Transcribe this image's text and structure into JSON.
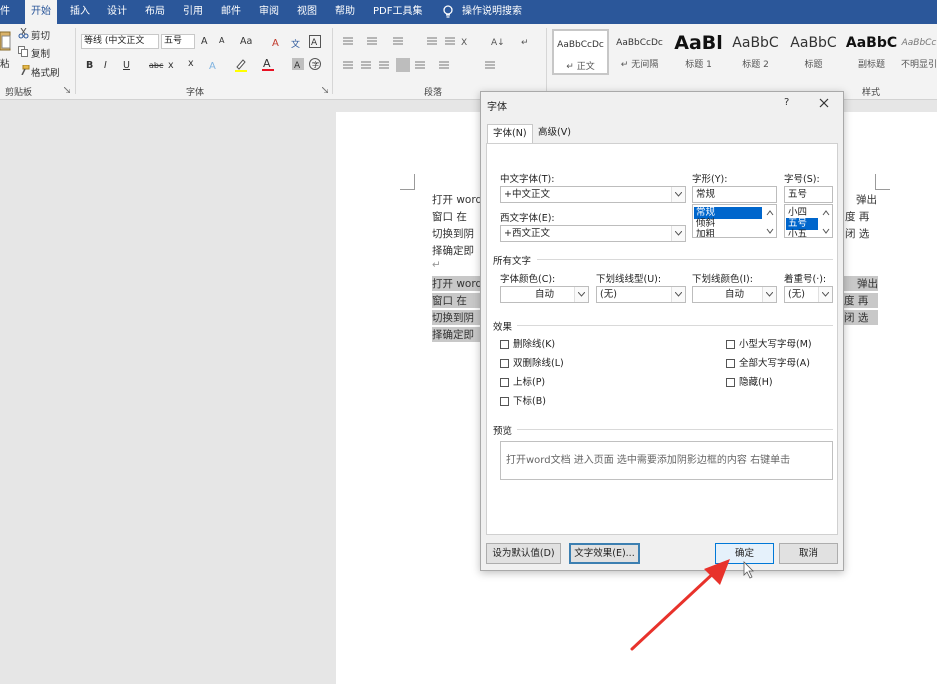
{
  "ribbon": {
    "tabs": [
      "件",
      "开始",
      "插入",
      "设计",
      "布局",
      "引用",
      "邮件",
      "审阅",
      "视图",
      "帮助",
      "PDF工具集",
      "操作说明搜索"
    ],
    "clipboard": {
      "cut": "剪切",
      "copy": "复制",
      "paste": "粘",
      "format_painter": "格式刷",
      "label": "剪贴板"
    },
    "font": {
      "name": "等线 (中文正文",
      "size": "五号",
      "grow": "A",
      "shrink": "A",
      "case": "Aa",
      "bold": "B",
      "italic": "I",
      "underline": "U",
      "strike": "abc",
      "subscript": "x",
      "superscript": "x",
      "label": "字体"
    },
    "paragraph": {
      "label": "段落"
    },
    "styles": {
      "label": "样式",
      "items": [
        {
          "preview": "AaBbCcDc",
          "name": "↵ 正文"
        },
        {
          "preview": "AaBbCcDc",
          "name": "↵ 无间隔"
        },
        {
          "preview": "AaBl",
          "name": "标题 1"
        },
        {
          "preview": "AaBbC",
          "name": "标题 2"
        },
        {
          "preview": "AaBbC",
          "name": "标题"
        },
        {
          "preview": "AaBbC",
          "name": "副标题"
        },
        {
          "preview": "AaBbCc",
          "name": "不明显引"
        }
      ]
    }
  },
  "document": {
    "lines_top": [
      "打开 word",
      "窗口 在",
      "切换到阴",
      "择确定即"
    ],
    "right_top": [
      "弹出",
      "度 再",
      "闭 选"
    ],
    "enter_mark": "↵",
    "lines_sel": [
      "打开 word",
      "窗口 在",
      "切换到阴",
      "择确定即"
    ],
    "right_sel": [
      "弹出",
      "度 再",
      "闭 选"
    ]
  },
  "dialog": {
    "title": "字体",
    "help": "?",
    "tabs": [
      "字体(N)",
      "高级(V)"
    ],
    "cn_font_label": "中文字体(T):",
    "cn_font_value": "+中文正文",
    "west_font_label": "西文字体(E):",
    "west_font_value": "+西文正文",
    "style_label": "字形(Y):",
    "style_value": "常规",
    "style_list": [
      "常规",
      "倾斜",
      "加粗"
    ],
    "size_label": "字号(S):",
    "size_value": "五号",
    "size_list": [
      "小四",
      "五号",
      "小五"
    ],
    "all_text": "所有文字",
    "color_label": "字体颜色(C):",
    "color_value": "自动",
    "underline_label": "下划线线型(U):",
    "underline_value": "(无)",
    "underline_color_label": "下划线颜色(I):",
    "underline_color_value": "自动",
    "emphasis_label": "着重号(·):",
    "emphasis_value": "(无)",
    "effects": "效果",
    "effects_left": [
      "删除线(K)",
      "双删除线(L)",
      "上标(P)",
      "下标(B)"
    ],
    "effects_right": [
      "小型大写字母(M)",
      "全部大写字母(A)",
      "隐藏(H)"
    ],
    "preview_label": "预览",
    "preview_text": "打开word文档  进入页面  选中需要添加阴影边框的内容  右键单击",
    "btn_default": "设为默认值(D)",
    "btn_effects": "文字效果(E)...",
    "btn_ok": "确定",
    "btn_cancel": "取消"
  },
  "colors": {
    "ribbon_blue": "#2b579a",
    "annotation_red": "#e8322b",
    "selection_blue": "#0066cc"
  }
}
